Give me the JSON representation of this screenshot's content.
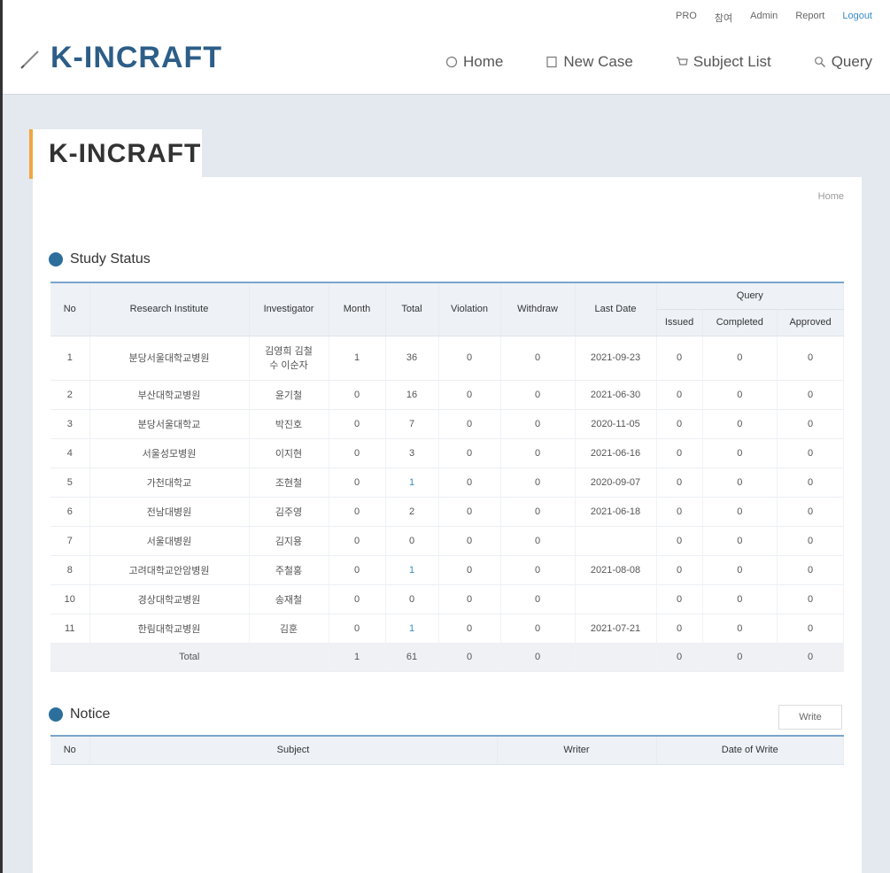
{
  "header": {
    "util_links": [
      "PRO",
      "참여",
      "Admin",
      "Report",
      "Logout"
    ],
    "logo": "K-INCRAFT",
    "nav": [
      "Home",
      "New Case",
      "Subject List",
      "Query"
    ]
  },
  "page": {
    "tab_title": "K-INCRAFT",
    "breadcrumb": "Home"
  },
  "study_status": {
    "title": "Study Status",
    "columns": [
      "No",
      "Research Institute",
      "Investigator",
      "Month",
      "Total",
      "Violation",
      "Withdraw",
      "Last Date",
      "Query"
    ],
    "query_subcolumns": [
      "Issued",
      "Completed",
      "Approved"
    ],
    "rows": [
      {
        "no": "1",
        "institute": "분당서울대학교병원",
        "investigator": "김영희 김철\n수 이순자",
        "month": "1",
        "total": "36",
        "violation": "0",
        "withdraw": "0",
        "last_date": "2021-09-23",
        "issued": "0",
        "completed": "0",
        "approved": "0"
      },
      {
        "no": "2",
        "institute": "부산대학교병원",
        "investigator": "윤기철",
        "month": "0",
        "total": "16",
        "violation": "0",
        "withdraw": "0",
        "last_date": "2021-06-30",
        "issued": "0",
        "completed": "0",
        "approved": "0"
      },
      {
        "no": "3",
        "institute": "분당서울대학교",
        "investigator": "박진호",
        "month": "0",
        "total": "7",
        "violation": "0",
        "withdraw": "0",
        "last_date": "2020-11-05",
        "issued": "0",
        "completed": "0",
        "approved": "0"
      },
      {
        "no": "4",
        "institute": "서울성모병원",
        "investigator": "이지현",
        "month": "0",
        "total": "3",
        "violation": "0",
        "withdraw": "0",
        "last_date": "2021-06-16",
        "issued": "0",
        "completed": "0",
        "approved": "0"
      },
      {
        "no": "5",
        "institute": "가천대학교",
        "investigator": "조현철",
        "month": "0",
        "total": "1",
        "violation": "0",
        "withdraw": "0",
        "last_date": "2020-09-07",
        "issued": "0",
        "completed": "0",
        "approved": "0"
      },
      {
        "no": "6",
        "institute": "전남대병원",
        "investigator": "김주영",
        "month": "0",
        "total": "2",
        "violation": "0",
        "withdraw": "0",
        "last_date": "2021-06-18",
        "issued": "0",
        "completed": "0",
        "approved": "0"
      },
      {
        "no": "7",
        "institute": "서울대병원",
        "investigator": "김지용",
        "month": "0",
        "total": "0",
        "violation": "0",
        "withdraw": "0",
        "last_date": "",
        "issued": "0",
        "completed": "0",
        "approved": "0"
      },
      {
        "no": "8",
        "institute": "고려대학교안암병원",
        "investigator": "주철홍",
        "month": "0",
        "total": "1",
        "violation": "0",
        "withdraw": "0",
        "last_date": "2021-08-08",
        "issued": "0",
        "completed": "0",
        "approved": "0"
      },
      {
        "no": "10",
        "institute": "경상대학교병원",
        "investigator": "송재철",
        "month": "0",
        "total": "0",
        "violation": "0",
        "withdraw": "0",
        "last_date": "",
        "issued": "0",
        "completed": "0",
        "approved": "0"
      },
      {
        "no": "11",
        "institute": "한림대학교병원",
        "investigator": "김훈",
        "month": "0",
        "total": "1",
        "violation": "0",
        "withdraw": "0",
        "last_date": "2021-07-21",
        "issued": "0",
        "completed": "0",
        "approved": "0"
      }
    ],
    "total_label": "Total",
    "totals": {
      "month": "1",
      "total": "61",
      "violation": "0",
      "withdraw": "0",
      "issued": "0",
      "completed": "0",
      "approved": "0"
    }
  },
  "notice": {
    "title": "Notice",
    "write_label": "Write",
    "columns": [
      "No",
      "Subject",
      "Writer",
      "Date of Write"
    ]
  },
  "colors": {
    "accent": "#2c6f9c",
    "tab_marker": "#f0a640",
    "link": "#3a8cc4"
  },
  "icons": {
    "logo": "pencil-icon",
    "home": "home-icon",
    "new_case": "document-icon",
    "subject_list": "cart-icon",
    "query": "search-icon"
  }
}
